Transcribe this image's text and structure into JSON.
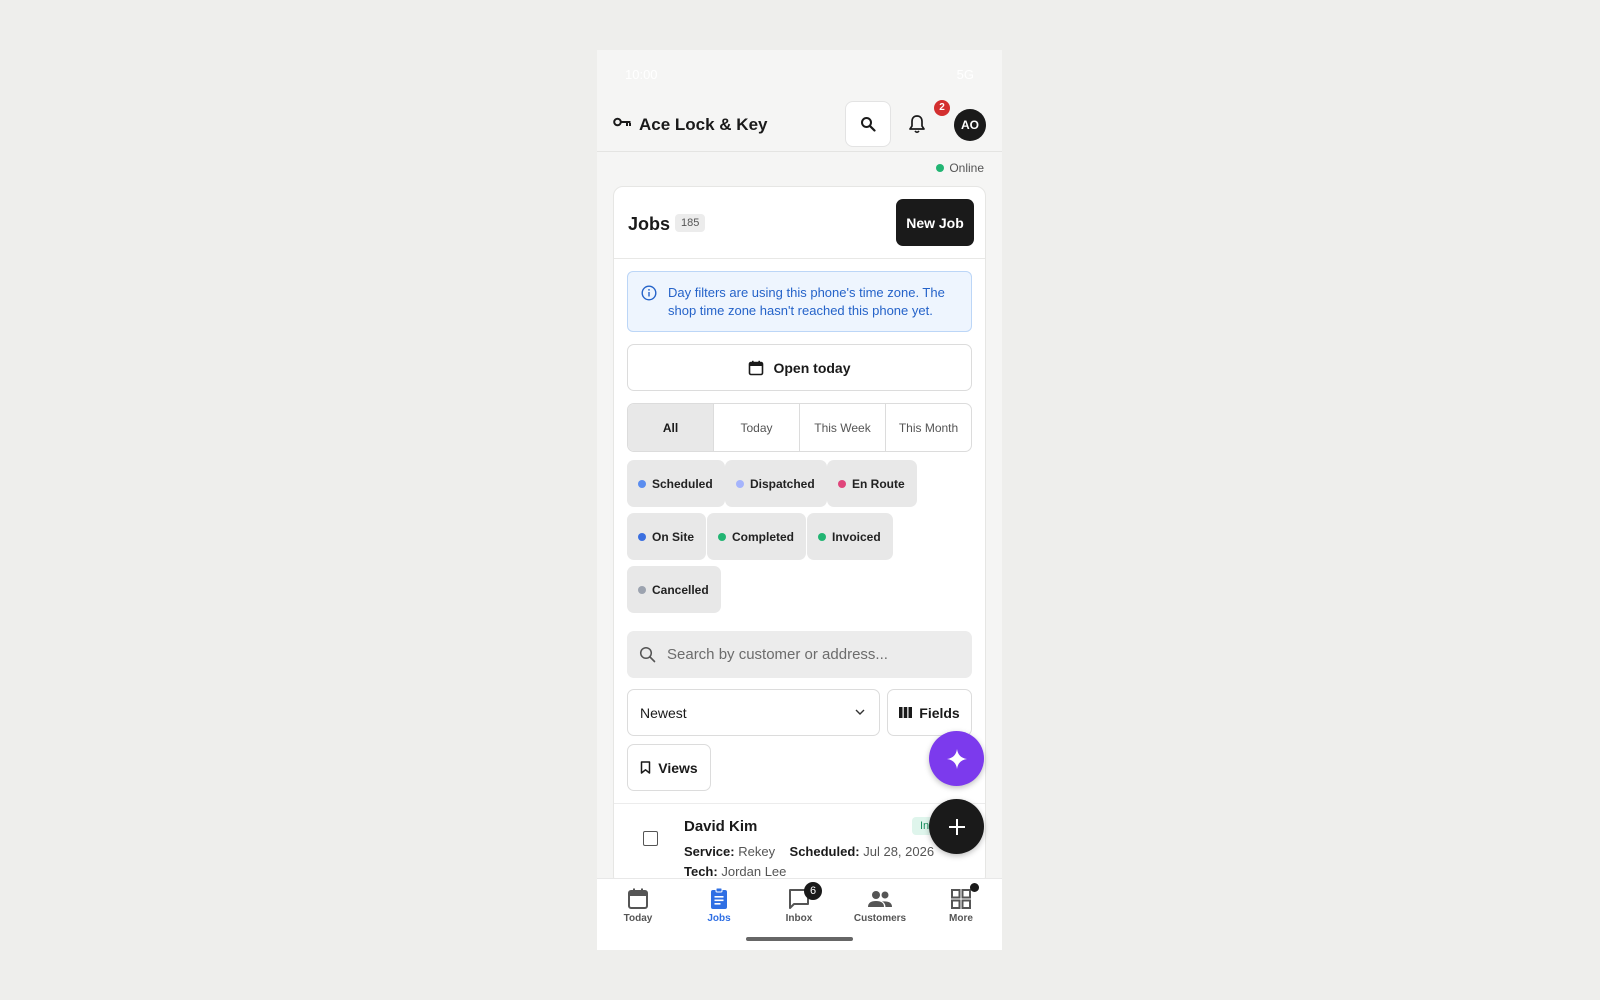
{
  "statusbar": {
    "time": "10:00",
    "network": "5G"
  },
  "appbar": {
    "brand": "Ace Lock & Key",
    "notifications_count": "2",
    "avatar_initials": "AO"
  },
  "connection": {
    "status": "Online",
    "color": "#22b573"
  },
  "jobs": {
    "title": "Jobs",
    "count": "185",
    "new_job_label": "New Job",
    "info_banner": "Day filters are using this phone's time zone. The shop time zone hasn't reached this phone yet.",
    "open_today_label": "Open today",
    "day_filters": [
      "All",
      "Today",
      "This Week",
      "This Month"
    ],
    "active_day_filter": "All",
    "status_filters": [
      {
        "label": "Scheduled",
        "color": "#5b8def"
      },
      {
        "label": "Dispatched",
        "color": "#a5b4fc"
      },
      {
        "label": "En Route",
        "color": "#e0457b"
      },
      {
        "label": "On Site",
        "color": "#3b6fe0"
      },
      {
        "label": "Completed",
        "color": "#22b573"
      },
      {
        "label": "Invoiced",
        "color": "#22b573"
      },
      {
        "label": "Cancelled",
        "color": "#9ca3af"
      }
    ],
    "search_placeholder": "Search by customer or address...",
    "sort_value": "Newest",
    "fields_label": "Fields",
    "views_label": "Views",
    "rows": [
      {
        "customer": "David Kim",
        "status_tag": "In",
        "service_label": "Service:",
        "service": "Rekey",
        "scheduled_label": "Scheduled:",
        "scheduled": "Jul 28, 2026",
        "tech_label": "Tech:",
        "tech": "Jordan Lee"
      }
    ]
  },
  "bottom_nav": {
    "items": [
      {
        "label": "Today",
        "icon": "calendar-icon"
      },
      {
        "label": "Jobs",
        "icon": "clipboard-icon"
      },
      {
        "label": "Inbox",
        "icon": "chat-icon",
        "badge": "6"
      },
      {
        "label": "Customers",
        "icon": "people-icon"
      },
      {
        "label": "More",
        "icon": "grid-icon"
      }
    ],
    "active": "Jobs"
  }
}
